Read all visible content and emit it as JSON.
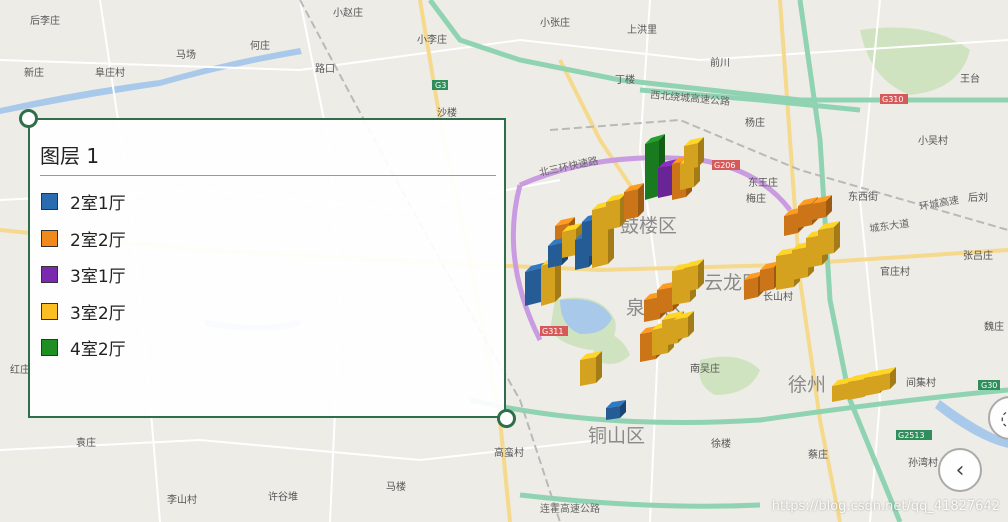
{
  "legend": {
    "title": "图层 1",
    "items": [
      {
        "label": "2室1厅",
        "color": "#2b6cb0"
      },
      {
        "label": "2室2厅",
        "color": "#f08a1c"
      },
      {
        "label": "3室1厅",
        "color": "#7b2aaf"
      },
      {
        "label": "3室2厅",
        "color": "#fbbf24"
      },
      {
        "label": "4室2厅",
        "color": "#1f8f24"
      }
    ]
  },
  "map": {
    "districts": [
      "鼓楼区",
      "泉山区",
      "云龙区",
      "铜山区",
      "徐州"
    ],
    "places": [
      "后李庄",
      "小赵庄",
      "何庄",
      "小李庄",
      "新庄",
      "阜庄村",
      "马场",
      "路口",
      "上洪里",
      "丁楼",
      "前川",
      "王台",
      "沙楼",
      "东王庄",
      "梅庄",
      "小吴村",
      "杨庄",
      "东西街",
      "后刘",
      "张吕庄",
      "官庄村",
      "长山村",
      "南吴庄",
      "间集村",
      "孙湾村",
      "蔡庄",
      "徐楼",
      "袁庄",
      "许谷堆",
      "李山村",
      "高蛮村",
      "马楼",
      "红庄",
      "魏庄",
      "小张庄"
    ],
    "roads": [
      "西北绕城高速公路",
      "北三环快速路",
      "城东大道",
      "连霍高速公路",
      "环城高速"
    ],
    "road_badges": [
      "G3",
      "G206",
      "G310",
      "G311",
      "G2513",
      "G30"
    ]
  },
  "controls": {
    "back_icon": "chevron-left-icon",
    "zoom_icon": "compass-icon"
  },
  "watermark": "https://blog.csdn.net/qq_41827642"
}
